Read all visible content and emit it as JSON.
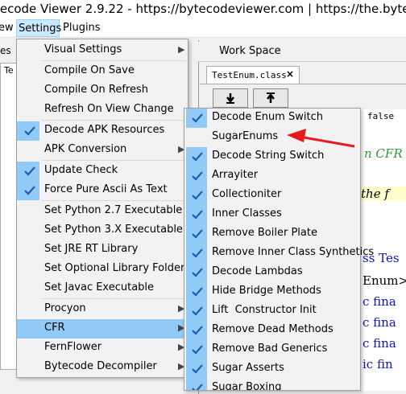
{
  "window": {
    "title": "tecode Viewer 2.9.22 - https://bytecodeviewer.com | https://the.bytec"
  },
  "menubar": {
    "view": "ew",
    "settings": "Settings",
    "plugins": "Plugins"
  },
  "left_panel": {
    "tab": "es",
    "tree_node": "Te"
  },
  "workspace": {
    "title": "Work Space",
    "tab_label": "TestEnum.class",
    "tab_close": "×",
    "code_snippets": [
      "false",
      "n CFR",
      "the f",
      "ss Tes",
      "Enum>",
      "c fina",
      "c fina",
      "c fina",
      "ic fin"
    ]
  },
  "settings_menu": {
    "items": [
      {
        "label": "Visual Settings",
        "submenu": true
      },
      {
        "label": "Compile On Save"
      },
      {
        "label": "Compile On Refresh"
      },
      {
        "label": "Refresh On View Change"
      },
      {
        "label": "Decode APK Resources",
        "checked": true
      },
      {
        "label": "APK Conversion",
        "submenu": true
      },
      {
        "label": "Update Check",
        "checked": true
      },
      {
        "label": "Force Pure Ascii As Text",
        "checked": true
      },
      {
        "label": "Set Python 2.7 Executable"
      },
      {
        "label": "Set Python 3.X Executable"
      },
      {
        "label": "Set JRE RT Library"
      },
      {
        "label": "Set Optional Library Folder"
      },
      {
        "label": "Set Javac Executable"
      },
      {
        "label": "Procyon",
        "submenu": true
      },
      {
        "label": "CFR",
        "submenu": true,
        "highlighted": true
      },
      {
        "label": "FernFlower",
        "submenu": true
      },
      {
        "label": "Bytecode Decompiler",
        "submenu": true
      }
    ]
  },
  "cfr_submenu": {
    "items": [
      {
        "label": "Decode Enum Switch",
        "checked": true
      },
      {
        "label": "SugarEnums",
        "checked": false
      },
      {
        "label": "Decode String Switch",
        "checked": true
      },
      {
        "label": "Arrayiter",
        "checked": true
      },
      {
        "label": "Collectioniter",
        "checked": true
      },
      {
        "label": "Inner Classes",
        "checked": true
      },
      {
        "label": "Remove Boiler Plate",
        "checked": true
      },
      {
        "label": "Remove Inner Class Synthetics",
        "checked": true
      },
      {
        "label": "Decode Lambdas",
        "checked": true
      },
      {
        "label": "Hide Bridge Methods",
        "checked": true
      },
      {
        "label": "Lift  Constructor Init",
        "checked": true
      },
      {
        "label": "Remove Dead Methods",
        "checked": true
      },
      {
        "label": "Remove Bad Generics",
        "checked": true
      },
      {
        "label": "Sugar Asserts",
        "checked": true
      },
      {
        "label": "Sugar Boxing",
        "checked": true
      }
    ]
  },
  "colors": {
    "highlight": "#91c9f7",
    "check": "#1a5fb4",
    "annotation_arrow": "#e8191d",
    "code_blue": "#1010c0",
    "code_green": "#2f9a2f"
  }
}
